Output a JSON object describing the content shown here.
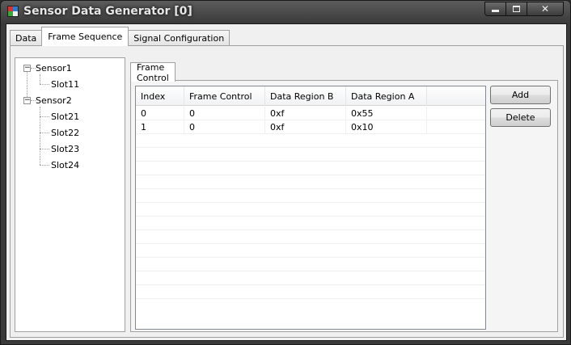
{
  "window": {
    "title": "Sensor Data Generator [0]"
  },
  "tabs": [
    {
      "label": "Data"
    },
    {
      "label": "Frame Sequence"
    },
    {
      "label": "Signal Configuration"
    }
  ],
  "active_tab": "Frame Sequence",
  "tree": {
    "nodes": [
      {
        "label": "Sensor1",
        "expanded": true,
        "children": [
          {
            "label": "Slot11"
          }
        ]
      },
      {
        "label": "Sensor2",
        "expanded": true,
        "children": [
          {
            "label": "Slot21"
          },
          {
            "label": "Slot22"
          },
          {
            "label": "Slot23"
          },
          {
            "label": "Slot24"
          }
        ]
      }
    ]
  },
  "inner_tab": {
    "label": "Frame Control"
  },
  "grid": {
    "columns": [
      "Index",
      "Frame Control",
      "Data Region B",
      "Data Region A"
    ],
    "rows": [
      [
        "0",
        "0",
        "0xf",
        "0x55"
      ],
      [
        "1",
        "0",
        "0xf",
        "0x10"
      ]
    ]
  },
  "buttons": {
    "add": "Add",
    "delete": "Delete"
  }
}
